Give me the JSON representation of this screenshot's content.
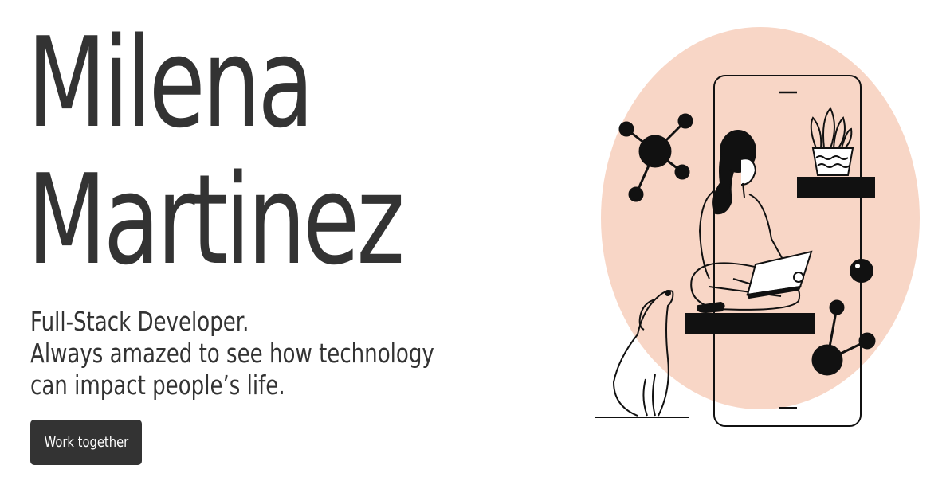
{
  "hero": {
    "name_line1": "Milena",
    "name_line2": "Martinez"
  },
  "tagline": {
    "line1": "Full-Stack Developer.",
    "line2": "Always amazed to see how technology",
    "line3": "can impact people’s life."
  },
  "cta": {
    "label": "Work together"
  },
  "colors": {
    "text": "#333333",
    "button_bg": "#333333",
    "button_text": "#ffffff",
    "blob": "#f8d6c6",
    "ink": "#111111"
  },
  "icons": {
    "illustration": "developer-with-laptop-illustration"
  }
}
